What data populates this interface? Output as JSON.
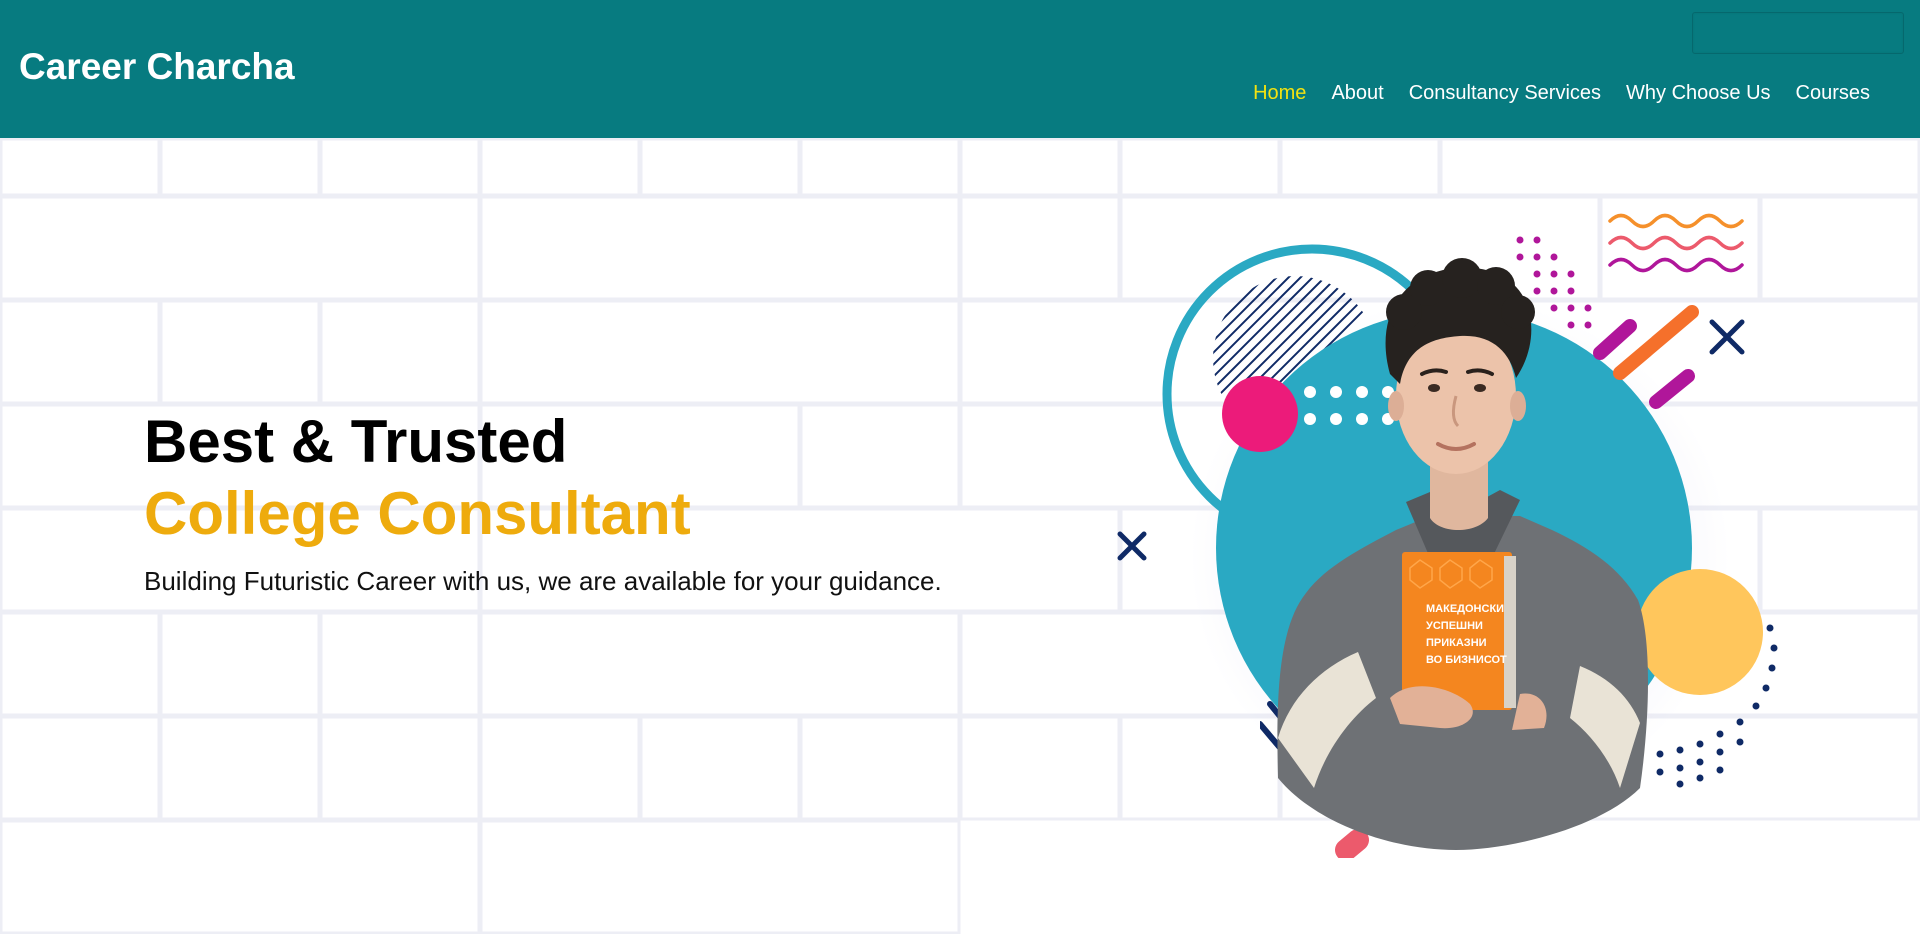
{
  "brand": "Career Charcha",
  "nav": [
    {
      "label": "Home",
      "active": true
    },
    {
      "label": "About",
      "active": false
    },
    {
      "label": "Consultancy Services",
      "active": false
    },
    {
      "label": "Why Choose Us",
      "active": false
    },
    {
      "label": "Courses",
      "active": false
    }
  ],
  "hero": {
    "title_line1": "Best & Trusted",
    "title_line2": "College Consultant",
    "subtitle": "Building Futuristic Career with us, we are available for your guidance."
  },
  "illustration": {
    "book_lines": [
      "МАКЕДОНСКИ",
      "УСПЕШНИ",
      "ПРИКАЗНИ",
      "ВО БИЗНИСОТ"
    ]
  },
  "colors": {
    "navbar": "#077b80",
    "active_nav": "#f3e210",
    "accent": "#eeab0d",
    "circle": "#2aa9c3",
    "pink": "#ec1b7a",
    "yellow": "#ffc65c",
    "navy": "#0f2a66",
    "magenta": "#b0169a",
    "orange": "#f5902b"
  }
}
